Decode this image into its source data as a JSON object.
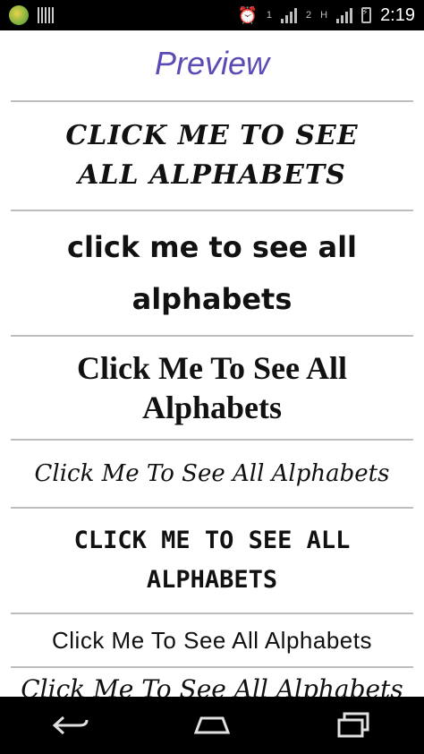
{
  "status_bar": {
    "sim_slot_1": "1",
    "sim_slot_2": "2",
    "network_type": "H",
    "time": "2:19"
  },
  "header": {
    "title": "Preview"
  },
  "font_previews": [
    {
      "text": "CLICK ME TO SEE ALL ALPHABETS"
    },
    {
      "text": "click me to see all alphabets"
    },
    {
      "text": "Click Me To See All Alphabets"
    },
    {
      "text": "Click Me To See All Alphabets"
    },
    {
      "text": "CLICK ME TO SEE ALL ALPHABETS"
    },
    {
      "text": "Click Me To See All Alphabets"
    },
    {
      "text": "Click Me To See All Alphabets"
    }
  ],
  "nav": {
    "back_icon": "back-arrow-icon",
    "home_icon": "home-icon",
    "recents_icon": "recents-icon"
  },
  "colors": {
    "title": "#5c4bb5",
    "divider": "#bdbdbd",
    "system_bars": "#000000"
  }
}
